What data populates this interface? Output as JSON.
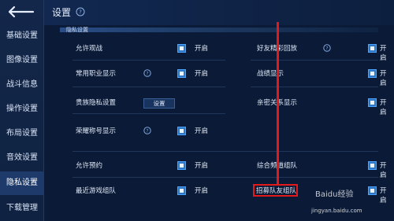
{
  "header": {
    "title": "设置"
  },
  "sidebar": {
    "items": [
      {
        "label": "基础设置"
      },
      {
        "label": "图像设置"
      },
      {
        "label": "战斗信息"
      },
      {
        "label": "操作设置"
      },
      {
        "label": "布局设置"
      },
      {
        "label": "音效设置"
      },
      {
        "label": "隐私设置",
        "active": true
      },
      {
        "label": "下载管理"
      }
    ]
  },
  "section": {
    "label": "隐私设置"
  },
  "left_column": [
    {
      "label": "允许观战",
      "value": "开启",
      "checked": true,
      "has_help": false
    },
    {
      "label": "常用职业显示",
      "value": "开启",
      "checked": true,
      "has_help": true
    },
    {
      "label": "贵族隐私设置",
      "button_label": "设置"
    },
    {
      "label": "荣耀称号显示",
      "value": "开启",
      "checked": true,
      "has_help": true
    },
    {
      "label": "允许预约",
      "value": "开启",
      "checked": true,
      "has_help": false
    },
    {
      "label": "最近游戏组队",
      "value": "开启",
      "checked": true,
      "has_help": false
    }
  ],
  "right_column": [
    {
      "label": "好友精彩回放",
      "value": "开启",
      "checked": true,
      "has_help": true
    },
    {
      "label": "战绩显示",
      "value": "开启",
      "checked": true,
      "has_help": false
    },
    {
      "label": "亲密关系显示",
      "value": "开启",
      "checked": true,
      "has_help": false
    },
    {
      "label": "综合频道组队",
      "value": "开启",
      "checked": true,
      "has_help": false
    },
    {
      "label": "招募队友组队",
      "value": "开启",
      "checked": true,
      "has_help": false
    }
  ],
  "watermark": {
    "text": "Baidu经验",
    "url": "jingyan.baidu.com"
  },
  "annotation": {
    "color": "#e41a1a"
  }
}
